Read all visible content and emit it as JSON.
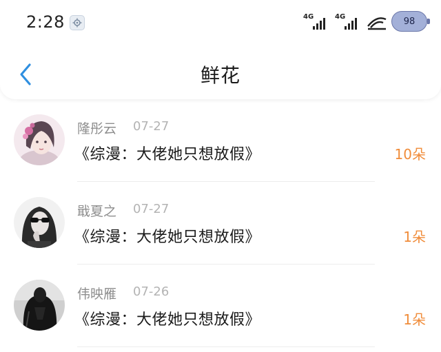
{
  "status_bar": {
    "time": "2:28",
    "signal_1_label": "4G",
    "signal_2_label": "4G",
    "battery": "98"
  },
  "header": {
    "title": "鲜花"
  },
  "records": [
    {
      "name": "隆彤云",
      "date": "07-27",
      "book": "《综漫：大佬她只想放假》",
      "count": "10朵"
    },
    {
      "name": "戢夏之",
      "date": "07-27",
      "book": "《综漫：大佬她只想放假》",
      "count": "1朵"
    },
    {
      "name": "伟映雁",
      "date": "07-26",
      "book": "《综漫：大佬她只想放假》",
      "count": "1朵"
    }
  ],
  "colors": {
    "accent": "#f08c3a",
    "back_arrow": "#2f8fe0"
  }
}
